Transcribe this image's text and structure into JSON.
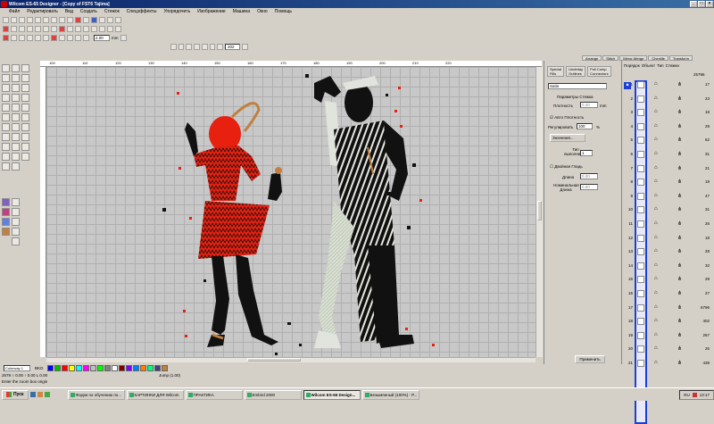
{
  "window": {
    "title": "Wilcom ES-65 Designer - [Copy of FST6     Tajima]",
    "controls": [
      "_",
      "□",
      "×"
    ]
  },
  "menu": [
    "Файл",
    "Редактировать",
    "Вид",
    "Создать",
    "Стежок",
    "Спецэффекты",
    "Упорядочить",
    "Изображение",
    "Машина",
    "Окно",
    "Помощь"
  ],
  "toolbar2": {
    "value": "2.00",
    "unit": "mm"
  },
  "toolbar3": {
    "zoom": "202"
  },
  "ruler_h_ticks": [
    "100",
    "110",
    "120",
    "130",
    "140",
    "150",
    "160",
    "170",
    "180",
    "190",
    "200",
    "210",
    "220"
  ],
  "top_tabs": [
    "Arrange",
    "Stitch",
    "Mirror-Merge",
    "Chenille",
    "Transform"
  ],
  "props": {
    "tabs": [
      "Special Fills",
      "Underlay Outlines",
      "Pull Comp Connectors"
    ],
    "fill_type": "Satin",
    "section": "Параметры Стежка",
    "density_label": "Плотность",
    "density_value": "0.40",
    "density_unit": "mm",
    "auto_density": "Авто Плотность",
    "adjust_label": "Регулировать",
    "adjust_value": "100",
    "adjust_unit": "%",
    "values_button": "Значения...",
    "stitch_label": "Тип выполнения",
    "stitch_value": "1",
    "double_label": "Двойная Гладь",
    "length_label": "Длина",
    "length_value": "0.00",
    "nominal_label": "Номинальная Длина",
    "nominal_value": "0.00",
    "apply_button": "Применить"
  },
  "objects": {
    "tabs": [
      "Порядок",
      "Объект",
      "Тип",
      "Стежки"
    ],
    "header_count": "25796",
    "rows": [
      {
        "num": "1",
        "stitches": "17"
      },
      {
        "num": "2",
        "stitches": "23"
      },
      {
        "num": "3",
        "stitches": "18"
      },
      {
        "num": "4",
        "stitches": "29"
      },
      {
        "num": "5",
        "stitches": "62"
      },
      {
        "num": "6",
        "stitches": "31"
      },
      {
        "num": "7",
        "stitches": "21"
      },
      {
        "num": "8",
        "stitches": "19"
      },
      {
        "num": "9",
        "stitches": "47"
      },
      {
        "num": "10",
        "stitches": "31"
      },
      {
        "num": "11",
        "stitches": "26"
      },
      {
        "num": "12",
        "stitches": "18"
      },
      {
        "num": "13",
        "stitches": "28"
      },
      {
        "num": "14",
        "stitches": "32"
      },
      {
        "num": "15",
        "stitches": "29"
      },
      {
        "num": "16",
        "stitches": "27"
      },
      {
        "num": "17",
        "stitches": "6796"
      },
      {
        "num": "18",
        "stitches": "402"
      },
      {
        "num": "19",
        "stitches": "267"
      },
      {
        "num": "20",
        "stitches": "26"
      },
      {
        "num": "21",
        "stitches": "439"
      }
    ]
  },
  "colorway": {
    "name": "Colorway 1",
    "mode": "BKG",
    "swatches": [
      "#0000ff",
      "#00c000",
      "#ff0000",
      "#ffff00",
      "#00ffff",
      "#ff00ff",
      "#c0c0c0",
      "#00ff00",
      "#808080",
      "#ffffff",
      "#800000",
      "#8000ff",
      "#0080ff",
      "#ff8000",
      "#00ff80",
      "#404080",
      "#c08040"
    ]
  },
  "status": {
    "line1": "2679  ○  0.00 ↑ 0.00 L  0.00 ",
    "jump": "Jump (1.00)",
    "line2": "Enter the zoom box origin"
  },
  "taskbar": {
    "start": "Пуск",
    "tasks": [
      "Форум по обучению по...",
      "КАРТИНКИ ДЛЯ Wilcom",
      "ПРАКТИКА",
      "Embird 2000",
      "Wilcom ES-65 Design...",
      "Безымянный (100%) - P..."
    ],
    "active_index": 4,
    "clock": "13:17",
    "lang": "RU"
  }
}
